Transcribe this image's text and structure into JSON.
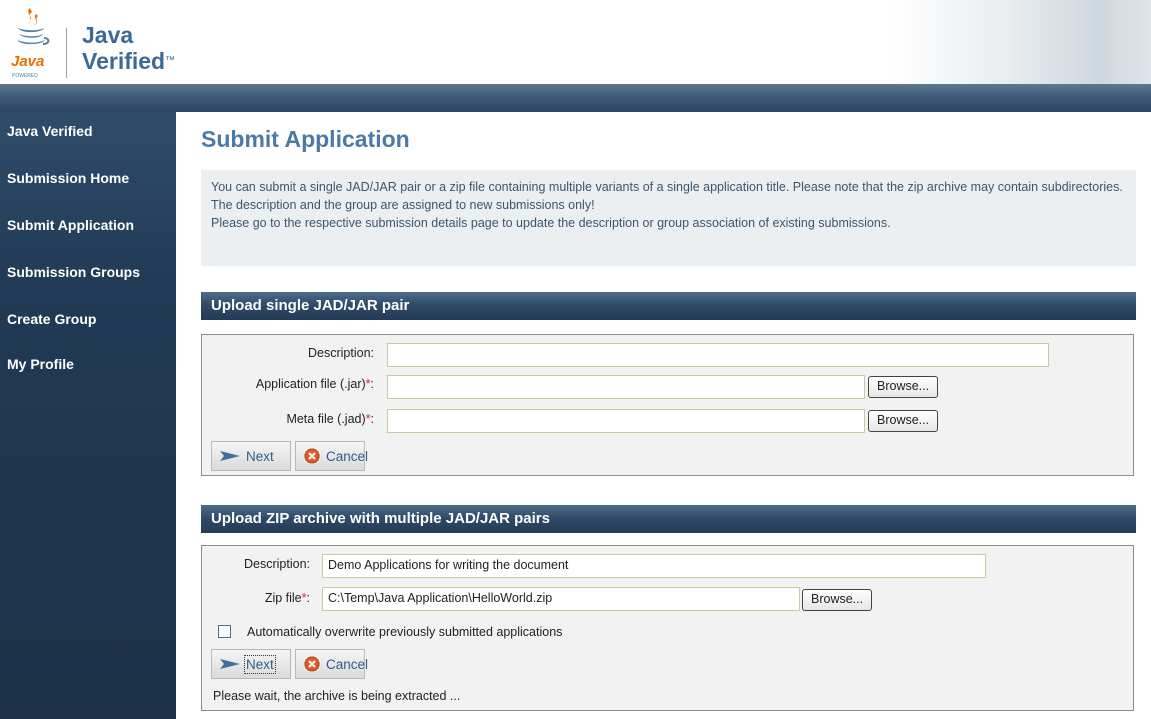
{
  "brand": {
    "powered": "POWERED",
    "java": "Java",
    "verified": "Verified",
    "tm": "™"
  },
  "nav": [
    {
      "label": "Java Verified"
    },
    {
      "label": "Submission Home"
    },
    {
      "label": "Submit Application"
    },
    {
      "label": "Submission Groups"
    },
    {
      "label": "Create Group"
    },
    {
      "label": "My Profile"
    }
  ],
  "page": {
    "title": "Submit Application",
    "info": [
      "You can submit a single JAD/JAR pair or a zip file containing multiple variants of a single application title. Please note that the zip archive may contain subdirectories.",
      "The description and the group are assigned to new submissions only!",
      "Please go to the respective submission details page to update the description or group association of existing submissions."
    ]
  },
  "single": {
    "heading": "Upload single JAD/JAR pair",
    "description_label": "Description:",
    "description_value": "",
    "jar_label": "Application file (.jar)",
    "jar_value": "",
    "jad_label": "Meta file (.jad)",
    "jad_value": "",
    "required_mark": "*",
    "colon": ":",
    "browse_label": "Browse...",
    "next_label": "Next",
    "cancel_label": "Cancel"
  },
  "zip": {
    "heading": "Upload ZIP archive with multiple JAD/JAR pairs",
    "description_label": "Description:",
    "description_value": "Demo Applications for writing the document",
    "zip_label": "Zip file",
    "zip_value": "C:\\Temp\\Java Application\\HelloWorld.zip",
    "required_mark": "*",
    "colon": ":",
    "browse_label": "Browse...",
    "overwrite_label": "Automatically overwrite previously submitted applications",
    "overwrite_checked": false,
    "next_label": "Next",
    "cancel_label": "Cancel",
    "status": "Please wait, the archive is being extracted ..."
  },
  "colors": {
    "accent": "#4a7aa5",
    "sidebar": "#213a55",
    "section_bar": "#2f4966",
    "required": "#d8262b"
  }
}
